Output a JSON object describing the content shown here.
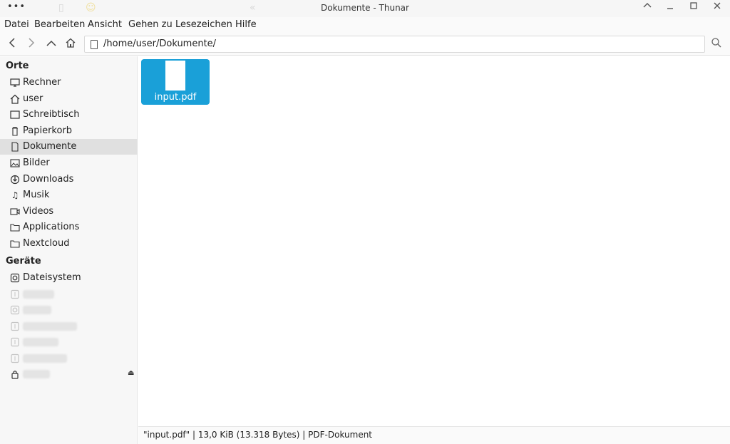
{
  "window": {
    "title": "Dokumente - Thunar",
    "menu_dots": "•••"
  },
  "menubar": [
    "Datei",
    "Bearbeiten",
    "Ansicht",
    "Gehen zu",
    "Lesezeichen",
    "Hilfe"
  ],
  "toolbar": {
    "back_icon": "chevron-left-icon",
    "forward_icon": "chevron-right-icon",
    "up_icon": "chevron-up-icon",
    "home_icon": "home-icon",
    "location_path": "/home/user/Dokumente/",
    "search_icon": "search-icon"
  },
  "sidebar": {
    "places_title": "Orte",
    "places": [
      {
        "label": "Rechner",
        "icon": "monitor-icon"
      },
      {
        "label": "user",
        "icon": "home-icon"
      },
      {
        "label": "Schreibtisch",
        "icon": "desktop-icon"
      },
      {
        "label": "Papierkorb",
        "icon": "trash-icon"
      },
      {
        "label": "Dokumente",
        "icon": "document-icon",
        "active": true
      },
      {
        "label": "Bilder",
        "icon": "image-icon"
      },
      {
        "label": "Downloads",
        "icon": "download-icon"
      },
      {
        "label": "Musik",
        "icon": "music-icon"
      },
      {
        "label": "Videos",
        "icon": "video-icon"
      },
      {
        "label": "Applications",
        "icon": "folder-icon"
      },
      {
        "label": "Nextcloud",
        "icon": "folder-icon"
      }
    ],
    "devices_title": "Geräte",
    "devices": [
      {
        "label": "Dateisystem",
        "icon": "drive-icon"
      }
    ]
  },
  "files": [
    {
      "name": "input.pdf",
      "icon": "pdf-file-icon",
      "selected": true
    }
  ],
  "statusbar": {
    "text": "\"input.pdf\" | 13,0 KiB (13.318 Bytes) | PDF-Dokument"
  },
  "colors": {
    "selection": "#1aa0d8",
    "sidebar_active": "#e0e0e0"
  }
}
